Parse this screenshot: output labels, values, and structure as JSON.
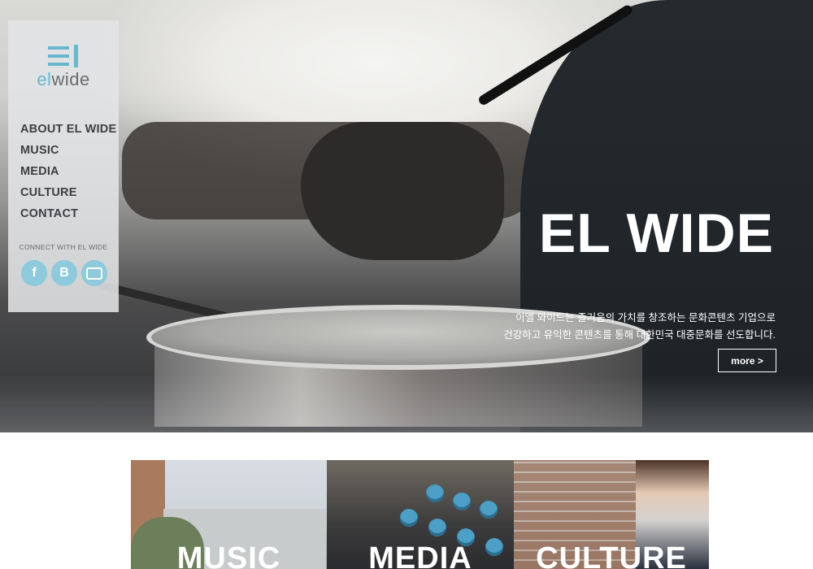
{
  "brand": {
    "logo_text_accent": "el",
    "logo_text_rest": "wide",
    "accent_color": "#67b8cf"
  },
  "sidebar": {
    "nav": [
      {
        "label": "ABOUT EL WIDE"
      },
      {
        "label": "MUSIC"
      },
      {
        "label": "MEDIA"
      },
      {
        "label": "CULTURE"
      },
      {
        "label": "CONTACT"
      }
    ],
    "connect_label": "CONNECT WITH EL WIDE",
    "socials": [
      {
        "icon": "facebook-icon",
        "glyph": "f"
      },
      {
        "icon": "blog-icon",
        "glyph": "B"
      },
      {
        "icon": "youtube-icon",
        "glyph": ""
      }
    ]
  },
  "hero": {
    "title": "EL WIDE",
    "desc_line1": "이엘 와이드는 즐거움의 가치를 창조하는 문화콘텐츠 기업으로",
    "desc_line2": "건강하고 유익한 콘텐츠를 통해 대한민국 대중문화를 선도합니다.",
    "more_label": "more >"
  },
  "tiles": [
    {
      "label": "MUSIC"
    },
    {
      "label": "MEDIA"
    },
    {
      "label": "CULTURE"
    }
  ]
}
